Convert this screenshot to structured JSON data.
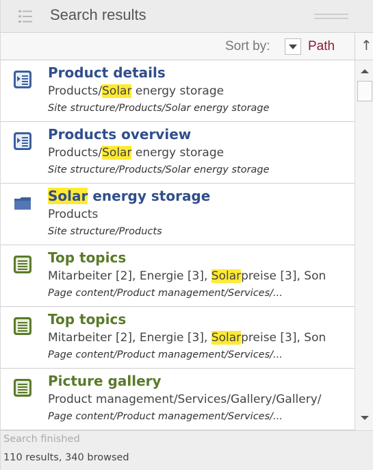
{
  "header": {
    "title": "Search results"
  },
  "sortbar": {
    "label": "Sort by:",
    "value": "Path",
    "direction_symbol": "↑"
  },
  "results": [
    {
      "icon": "page-icon",
      "title": "Product details",
      "path_pre": "Products/",
      "path_hl": "Solar",
      "path_post": " energy storage",
      "location": "Site structure/Products/Solar energy storage"
    },
    {
      "icon": "page-icon",
      "title": "Products overview",
      "path_pre": "Products/",
      "path_hl": "Solar",
      "path_post": " energy storage",
      "location": "Site structure/Products/Solar energy storage"
    },
    {
      "icon": "folder-icon",
      "title_hl": "Solar",
      "title_post": " energy storage",
      "path": "Products",
      "location": "Site structure/Products"
    },
    {
      "icon": "content-icon",
      "title": "Top topics",
      "path_pre": "Mitarbeiter [2], Energie [3], ",
      "path_hl": "Solar",
      "path_post": "preise [3], Son",
      "location": "Page content/Product management/Services/..."
    },
    {
      "icon": "content-icon",
      "title": "Top topics",
      "path_pre": "Mitarbeiter [2], Energie [3], ",
      "path_hl": "Solar",
      "path_post": "preise [3], Son",
      "location": "Page content/Product management/Services/..."
    },
    {
      "icon": "content-icon",
      "title": "Picture gallery",
      "path": "Product management/Services/Gallery/Gallery/",
      "location": "Page content/Product management/Services/..."
    }
  ],
  "footer": {
    "status": "Search finished",
    "count": "110 results, 340 browsed"
  },
  "colors": {
    "title_blue": "#2f4e8c",
    "title_green": "#5a7a2a",
    "sort_value": "#8b1a35",
    "highlight": "#ffea32"
  }
}
